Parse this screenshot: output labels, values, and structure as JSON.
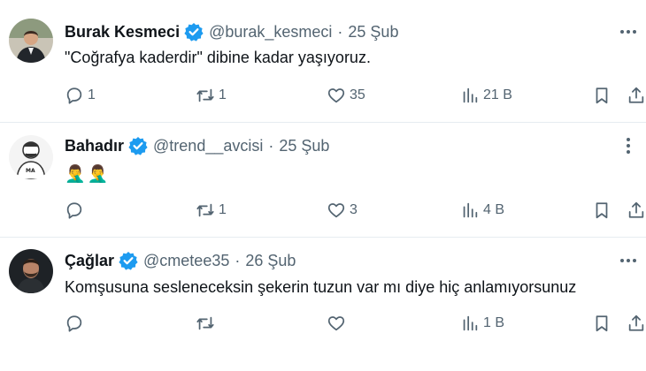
{
  "tweets": [
    {
      "name": "Burak Kesmeci",
      "handle": "@burak_kesmeci",
      "separator": "·",
      "date": "25 Şub",
      "text": "\"Coğrafya kaderdir\" dibine kadar yaşıyoruz.",
      "replies": "1",
      "retweets": "1",
      "likes": "35",
      "views": "21 B"
    },
    {
      "name": "Bahadır",
      "handle": "@trend__avcisi",
      "separator": "·",
      "date": "25 Şub",
      "text": "🤦‍♂️🤦‍♂️",
      "replies": "",
      "retweets": "1",
      "likes": "3",
      "views": "4 B"
    },
    {
      "name": "Çağlar",
      "handle": "@cmetee35",
      "separator": "·",
      "date": "26 Şub",
      "text": "Komşusuna sesleneceksin şekerin tuzun var mı diye hiç anlamıyorsunuz",
      "replies": "",
      "retweets": "",
      "likes": "",
      "views": "1 B"
    }
  ],
  "colors": {
    "verified_blue": "#1d9bf0",
    "text_primary": "#0f1419",
    "text_secondary": "#536471",
    "divider": "#e6ecf0"
  },
  "icons": [
    "verified-badge-icon",
    "more-icon",
    "reply-icon",
    "retweet-icon",
    "like-icon",
    "views-icon",
    "bookmark-icon",
    "share-icon"
  ]
}
